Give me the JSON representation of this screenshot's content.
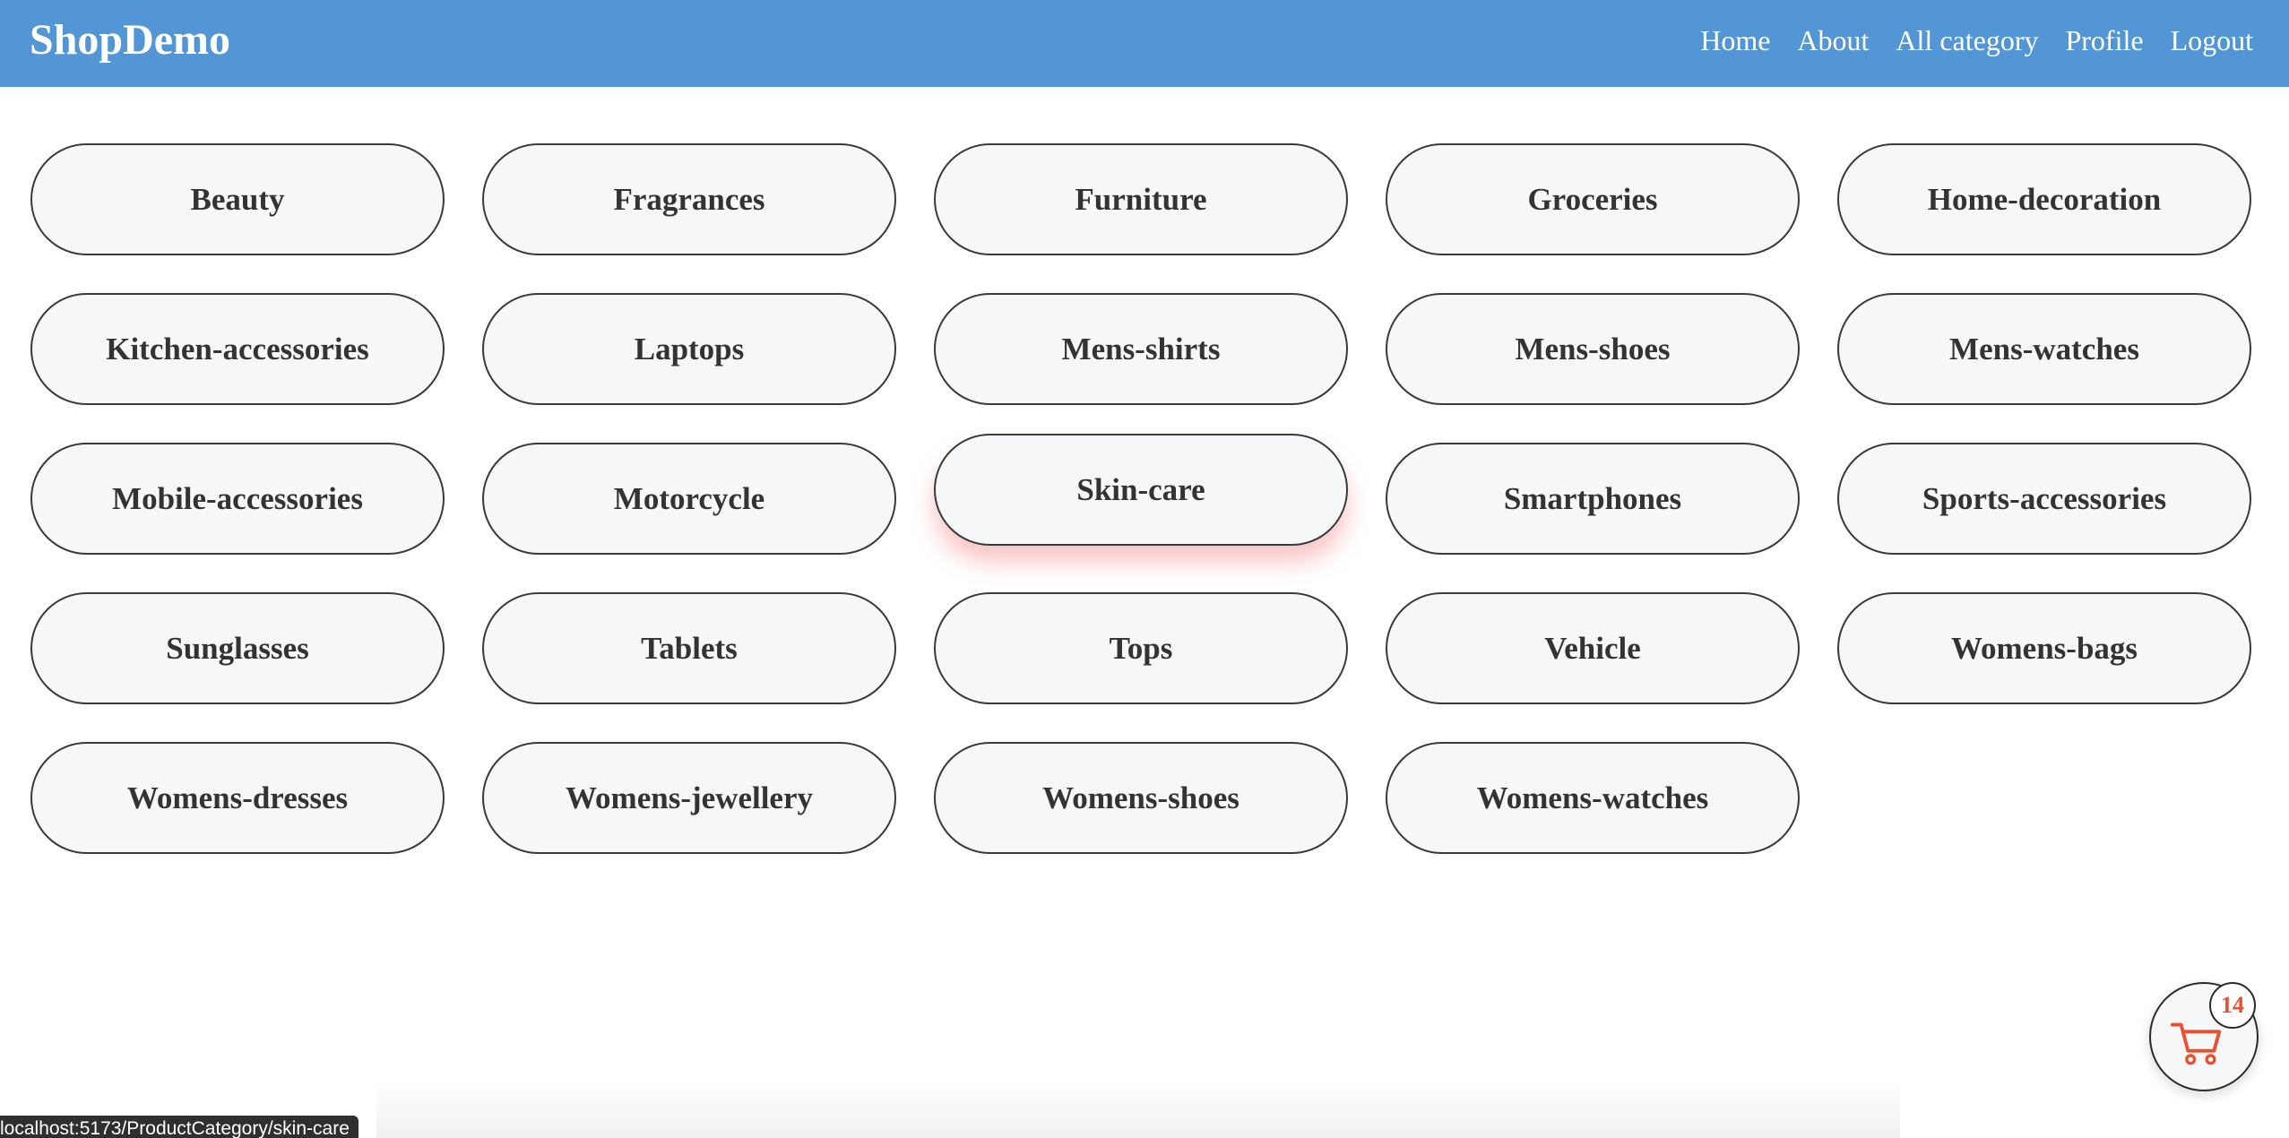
{
  "navbar": {
    "brand": "ShopDemo",
    "links": [
      "Home",
      "About",
      "All category",
      "Profile",
      "Logout"
    ],
    "background_color": "#5396d6"
  },
  "categories": [
    "Beauty",
    "Fragrances",
    "Furniture",
    "Groceries",
    "Home-decoration",
    "Kitchen-accessories",
    "Laptops",
    "Mens-shirts",
    "Mens-shoes",
    "Mens-watches",
    "Mobile-accessories",
    "Motorcycle",
    "Skin-care",
    "Smartphones",
    "Sports-accessories",
    "Sunglasses",
    "Tablets",
    "Tops",
    "Vehicle",
    "Womens-bags",
    "Womens-dresses",
    "Womens-jewellery",
    "Womens-shoes",
    "Womens-watches"
  ],
  "hovered_category": "Skin-care",
  "cart": {
    "icon": "shopping-cart-icon",
    "count": "14",
    "icon_color": "#e8502f"
  },
  "status_bar": {
    "url": "localhost:5173/ProductCategory/skin-care"
  }
}
